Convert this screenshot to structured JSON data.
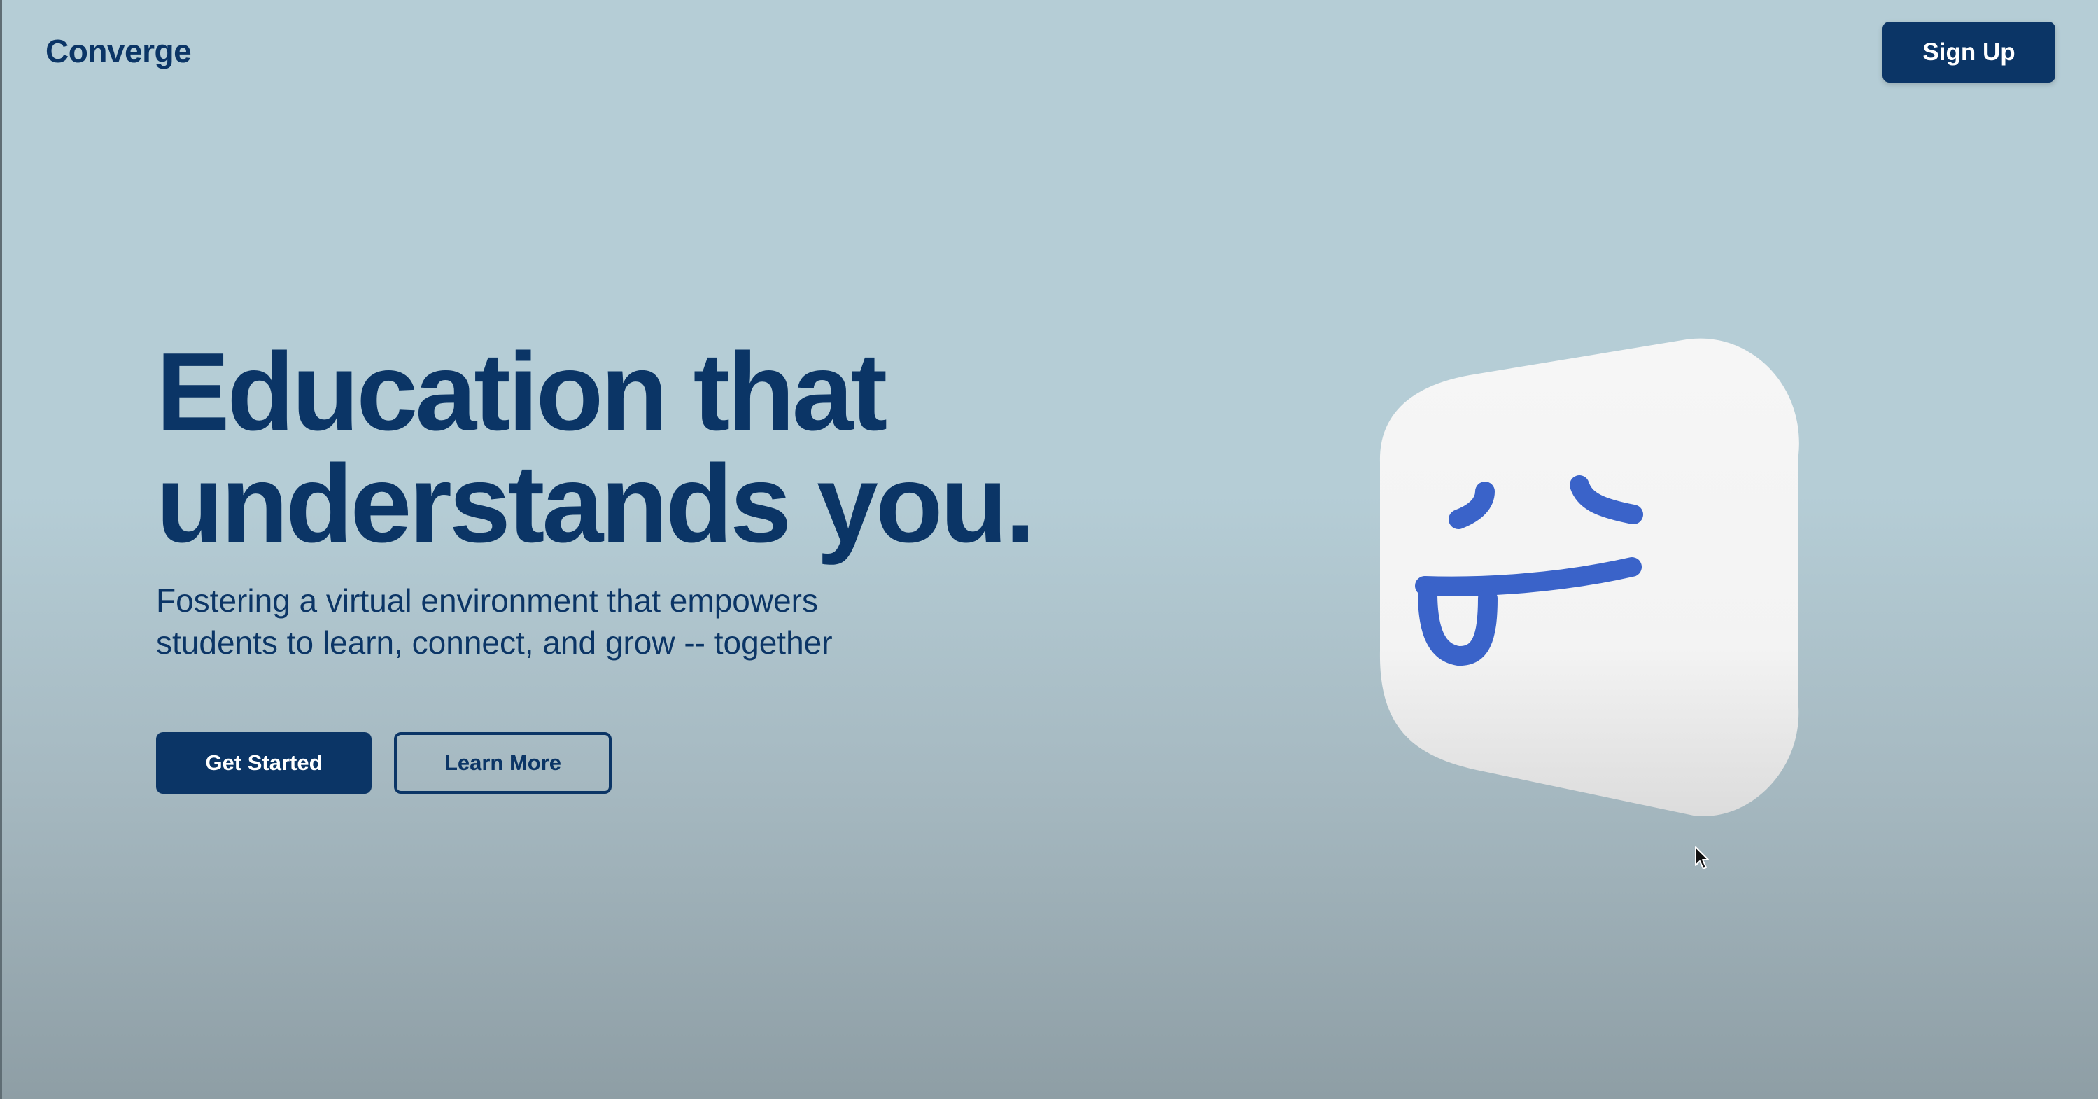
{
  "header": {
    "logo_text": "Converge",
    "signup_label": "Sign Up"
  },
  "hero": {
    "headline_line1": "Education that",
    "headline_line2": "understands you.",
    "subtitle_line1": "Fostering a virtual environment that empowers",
    "subtitle_line2": "students to learn, connect, and grow -- together"
  },
  "actions": {
    "primary_label": "Get Started",
    "secondary_label": "Learn More"
  },
  "illustration": {
    "icon": "tongue-out-face-icon",
    "face_color": "#3a63c9",
    "tile_color": "#f5f5f5"
  },
  "colors": {
    "brand": "#0b3566",
    "background_top": "#b5cdd6",
    "background_bottom": "#8e9ea5"
  }
}
